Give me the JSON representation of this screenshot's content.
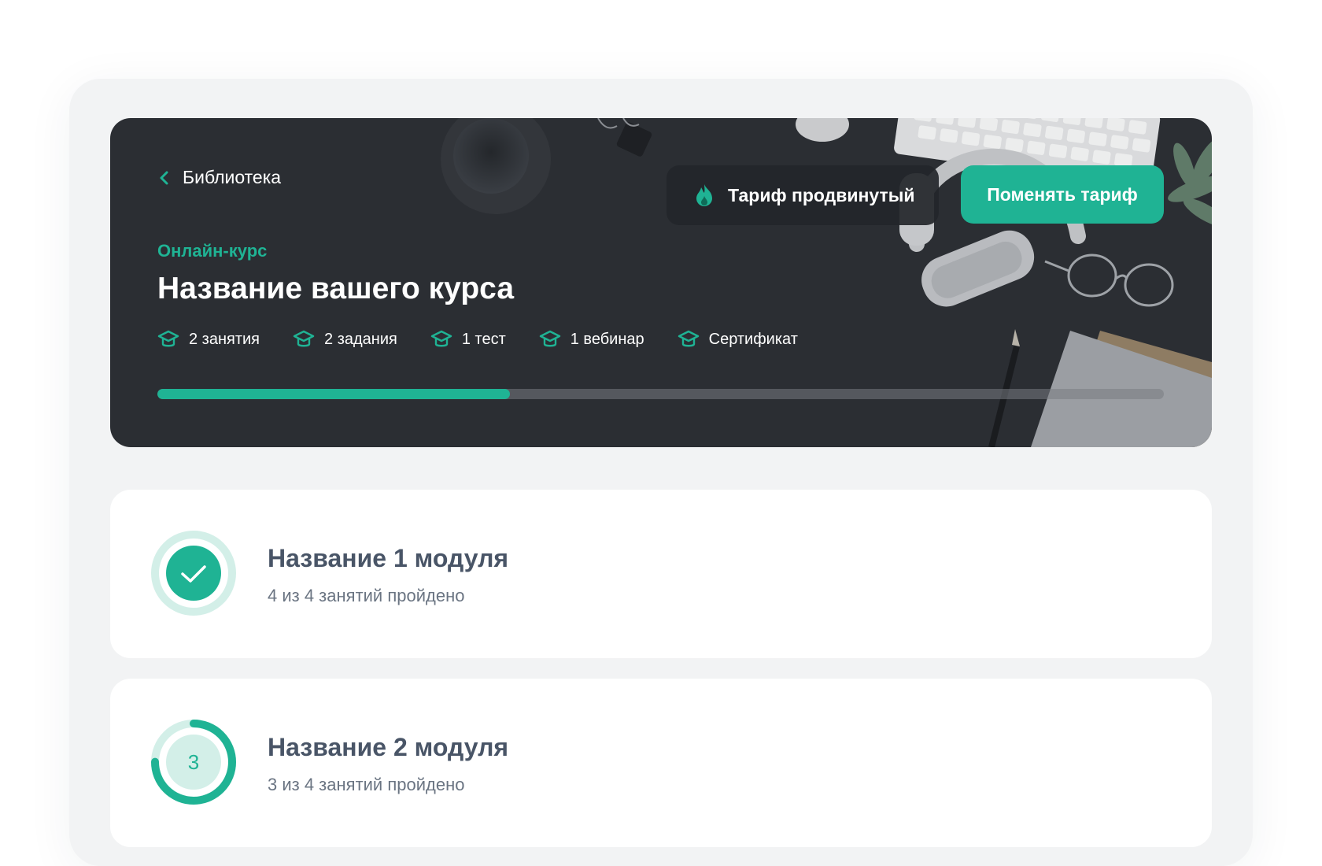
{
  "hero": {
    "back_label": "Библиотека",
    "tariff_label": "Тариф продвинутый",
    "change_button": "Поменять тариф",
    "course_type": "Онлайн-курс",
    "course_title": "Название вашего курса",
    "features": [
      {
        "icon": "graduation-cap-icon",
        "label": "2 занятия"
      },
      {
        "icon": "graduation-cap-icon",
        "label": "2 задания"
      },
      {
        "icon": "graduation-cap-icon",
        "label": "1 тест"
      },
      {
        "icon": "graduation-cap-icon",
        "label": "1 вебинар"
      },
      {
        "icon": "graduation-cap-icon",
        "label": "Сертификат"
      }
    ],
    "progress_fraction": 0.35
  },
  "modules": [
    {
      "title": "Название 1 модуля",
      "subtitle": "4 из 4 занятий пройдено",
      "completed": 4,
      "total": 4,
      "status_icon": "check-icon"
    },
    {
      "title": "Название 2 модуля",
      "subtitle": "3 из 4 занятий пройдено",
      "completed": 3,
      "total": 4,
      "number": "3"
    }
  ],
  "colors": {
    "accent": "#1fb394",
    "accent_light": "#d3efe8",
    "hero_bg": "#2b2e33",
    "page_bg": "#f2f3f4",
    "text_dark": "#495567",
    "text_muted": "#6a7482"
  }
}
